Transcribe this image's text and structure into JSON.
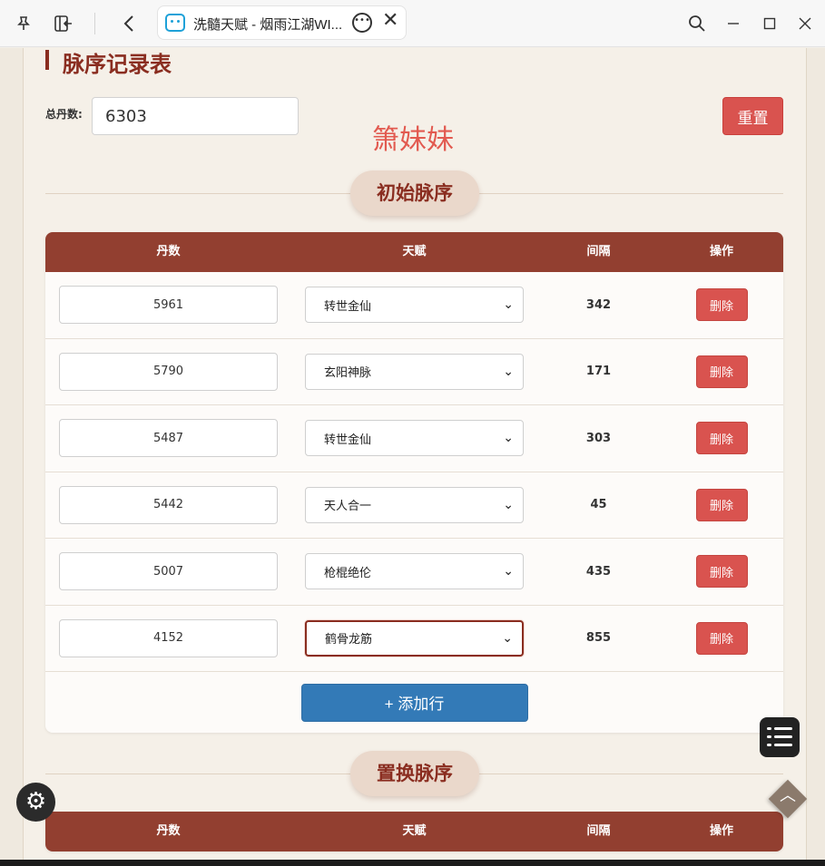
{
  "browser": {
    "tab_title": "洗髓天赋 - 烟雨江湖WI...",
    "icons": [
      "pin-icon",
      "sidebar-icon",
      "back-icon",
      "bilibili-icon",
      "more-icon",
      "close-icon",
      "search-icon",
      "minimize-icon",
      "maximize-icon",
      "window-close-icon"
    ]
  },
  "page": {
    "title": "脉序记录表",
    "total_label": "总丹数:",
    "total_value": "6303",
    "watermark": "箫妹妹",
    "reset_label": "重置",
    "initial_section": "初始脉序",
    "replace_section": "置换脉序",
    "add_row_label": "+ 添加行"
  },
  "table_headers": {
    "dan": "丹数",
    "talent": "天赋",
    "gap": "间隔",
    "action": "操作"
  },
  "rows": [
    {
      "dan": "5961",
      "talent": "转世金仙",
      "gap": "342",
      "action": "删除"
    },
    {
      "dan": "5790",
      "talent": "玄阳神脉",
      "gap": "171",
      "action": "删除"
    },
    {
      "dan": "5487",
      "talent": "转世金仙",
      "gap": "303",
      "action": "删除"
    },
    {
      "dan": "5442",
      "talent": "天人合一",
      "gap": "45",
      "action": "删除"
    },
    {
      "dan": "5007",
      "talent": "枪棍绝伦",
      "gap": "435",
      "action": "删除"
    },
    {
      "dan": "4152",
      "talent": "鹤骨龙筋",
      "gap": "855",
      "action": "删除"
    }
  ],
  "colors": {
    "accent": "#8a2d20",
    "header_bg": "#923f30",
    "danger": "#d9534f",
    "primary": "#337ab7"
  }
}
